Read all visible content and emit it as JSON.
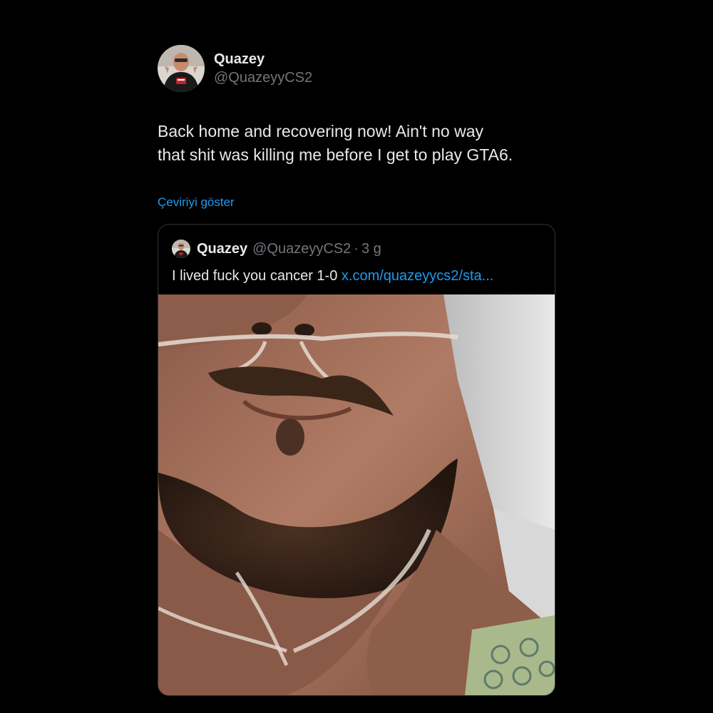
{
  "author": {
    "name": "Quazey",
    "handle": "@QuazeyyCS2",
    "avatar_icon": "profile-avatar"
  },
  "tweet": {
    "text": "Back home and recovering now! Ain't no way\nthat shit was killing me before I get to play GTA6.",
    "translate_label": "Çeviriyi göster"
  },
  "quote": {
    "name": "Quazey",
    "handle": "@QuazeyyCS2",
    "separator": "·",
    "time": "3 g",
    "text": "I lived fuck you cancer 1-0 ",
    "link": "x.com/quazeyycs2/sta...",
    "media_alt": "photo"
  },
  "colors": {
    "background": "#000000",
    "text": "#e7e9ea",
    "secondary": "#71767b",
    "accent": "#1d9bf0",
    "border": "#2f3336"
  }
}
